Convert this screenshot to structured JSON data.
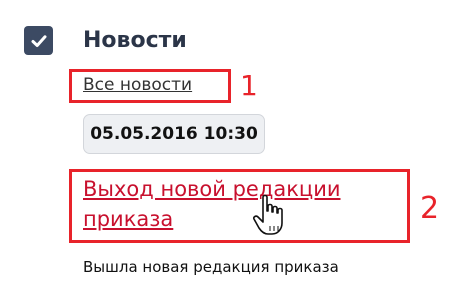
{
  "section": {
    "title": "Новости",
    "checked": true
  },
  "all_news": {
    "label": "Все новости",
    "marker": "1"
  },
  "news_item": {
    "date": "05.05.2016 10:30",
    "link_text": "Выход новой редакции приказа",
    "marker": "2",
    "description": "Вышла новая редакция приказа"
  },
  "colors": {
    "checkbox": "#3c4a63",
    "highlight": "#e8232a",
    "link": "#c8102e"
  },
  "icons": {
    "checkbox": "checkmark-icon",
    "cursor": "hand-pointer-icon"
  }
}
